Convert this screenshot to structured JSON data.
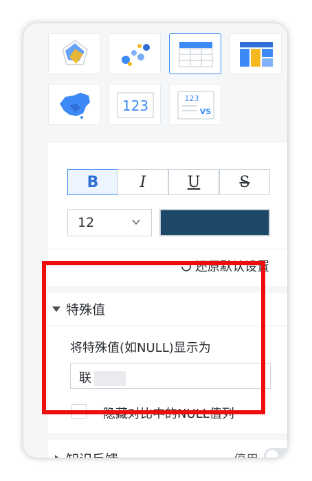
{
  "charts": {
    "tiles": [
      {
        "icon": "radar-chart-icon"
      },
      {
        "icon": "scatter-chart-icon"
      },
      {
        "icon": "table-icon",
        "selected": true
      },
      {
        "icon": "treemap-icon"
      },
      {
        "icon": "china-map-icon"
      },
      {
        "icon": "kpi-number-icon",
        "text": "123"
      },
      {
        "icon": "kpi-compare-icon",
        "text": "123",
        "text2": "VS"
      }
    ]
  },
  "format": {
    "bold": "B",
    "italic": "I",
    "underline": "U",
    "strike": "S",
    "font_size": "12",
    "color": "#1e4868",
    "reset_label": "还原默认设置"
  },
  "special_values": {
    "title": "特殊值",
    "display_label": "将特殊值(如NULL)显示为",
    "display_value": "联",
    "hide_null_label": "隐藏对比中的NULL值列"
  },
  "knowledge": {
    "title": "知识反馈",
    "toggle_label": "停用"
  },
  "colors": {
    "accent": "#3d8af7",
    "highlight": "#ee0d0d"
  }
}
